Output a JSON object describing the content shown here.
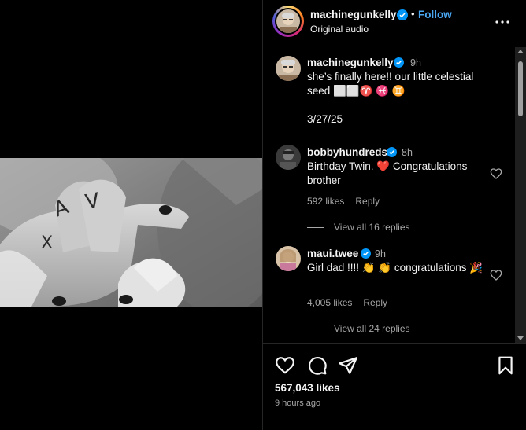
{
  "post_header": {
    "username": "machinegunkelly",
    "separator": "•",
    "follow_label": "Follow",
    "audio_label": "Original audio"
  },
  "caption": {
    "username": "machinegunkelly",
    "time": "9h",
    "text": "she’s finally here!! our little celestial seed ⬜⬜♈️ ♓️ ♊️",
    "date": "3/27/25"
  },
  "comments": [
    {
      "username": "bobbyhundreds",
      "time": "8h",
      "text": "Birthday Twin. ❤️  Congratulations brother",
      "likes": "592 likes",
      "reply_label": "Reply",
      "view_replies": "View all 16 replies"
    },
    {
      "username": "maui.twee",
      "time": "9h",
      "text": "Girl dad !!!! 👏 👏  congratulations 🎉",
      "likes": "4,005 likes",
      "reply_label": "Reply",
      "view_replies": "View all 24 replies"
    }
  ],
  "footer": {
    "likes": "567,043 likes",
    "posted": "9 hours ago"
  },
  "colors": {
    "background": "#000000",
    "text": "#f5f5f5",
    "secondary_text": "#a8a8a8",
    "follow_blue": "#4aa6ef",
    "verified_blue": "#0095f6",
    "divider": "#262626"
  },
  "icons": [
    "more-options-icon",
    "verified-badge-icon",
    "heart-outline-icon",
    "comment-icon",
    "share-icon",
    "bookmark-icon"
  ]
}
